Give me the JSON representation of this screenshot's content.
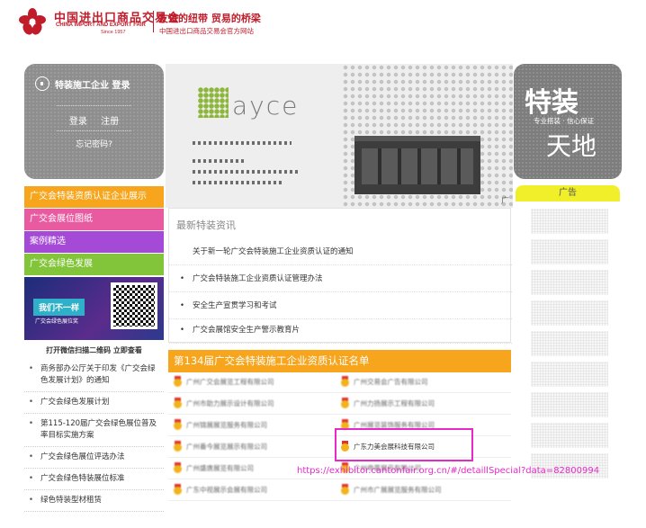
{
  "header": {
    "logo_cn": "中国进出口商品交易会",
    "logo_en": "CHINA IMPORT AND EXPORT FAIR",
    "logo_since": "Since 1957",
    "slogan": "友谊的纽带 贸易的桥梁",
    "site_name": "中国进出口商品交易会官方网站"
  },
  "login": {
    "title": "特装施工企业 登录",
    "login_link": "登录",
    "register_link": "注册",
    "forgot_link": "忘记密码?"
  },
  "banner": {
    "brand": "ayce",
    "corner_text": "广"
  },
  "special": {
    "big_text": "特装",
    "tagline": "专业搭装 · 信心保证",
    "big_text2": "天地"
  },
  "menu": {
    "items": [
      {
        "label": "广交会特装资质认证企业展示",
        "color": "#f6a51c"
      },
      {
        "label": "广交会展位图纸",
        "color": "#e85ba0"
      },
      {
        "label": "案例精选",
        "color": "#a44ad6"
      },
      {
        "label": "广交会绿色发展",
        "color": "#82c43a"
      }
    ],
    "qr_slogan": "我们不一样",
    "qr_sub": "广交会绿色展位奖",
    "qr_caption": "打开微信扫描二维码 立即查看"
  },
  "links": [
    "商务部办公厅关于印发《广交会绿色发展计划》的通知",
    "广交会绿色发展计划",
    "第115-120届广交会绿色展位普及率目标实施方案",
    "广交会绿色展位评选办法",
    "广交会绿色特装展位标准",
    "绿色特装型材租赁"
  ],
  "ad": {
    "title": "广告"
  },
  "news": {
    "title": "最新特装资讯",
    "items": [
      "关于新一轮广交会特装施工企业资质认证的通知",
      "广交会特装施工企业资质认证管理办法",
      "安全生产宣贯学习和考试",
      "广交会展馆安全生产警示教育片"
    ]
  },
  "list": {
    "title": "第134届广交会特装施工企业资质认证名单",
    "rows": [
      [
        "广州广交会展览工程有限公司",
        "广州交易会广告有限公司"
      ],
      [
        "广州市助力展示设计有限公司",
        "广州力扬展示工程有限公司"
      ],
      [
        "广州锦展展览服务有限公司",
        "广州展览装饰服务有限公司"
      ],
      [
        "广州番今展览展示有限公司",
        "广东力美会展科技有限公司"
      ],
      [
        "广州盛唐展览有限公司",
        "广州帝豪展示有限公司"
      ],
      [
        "广东中视展示会展有限公司",
        "广州市广展展览服务有限公司"
      ]
    ],
    "highlight_company": "广东力美会展科技有限公司"
  },
  "annotation": {
    "url": "https://exhibitor.cantonfair.org.cn/#/detaillSpecial?data=82800994",
    "color": "#e52ac9"
  }
}
